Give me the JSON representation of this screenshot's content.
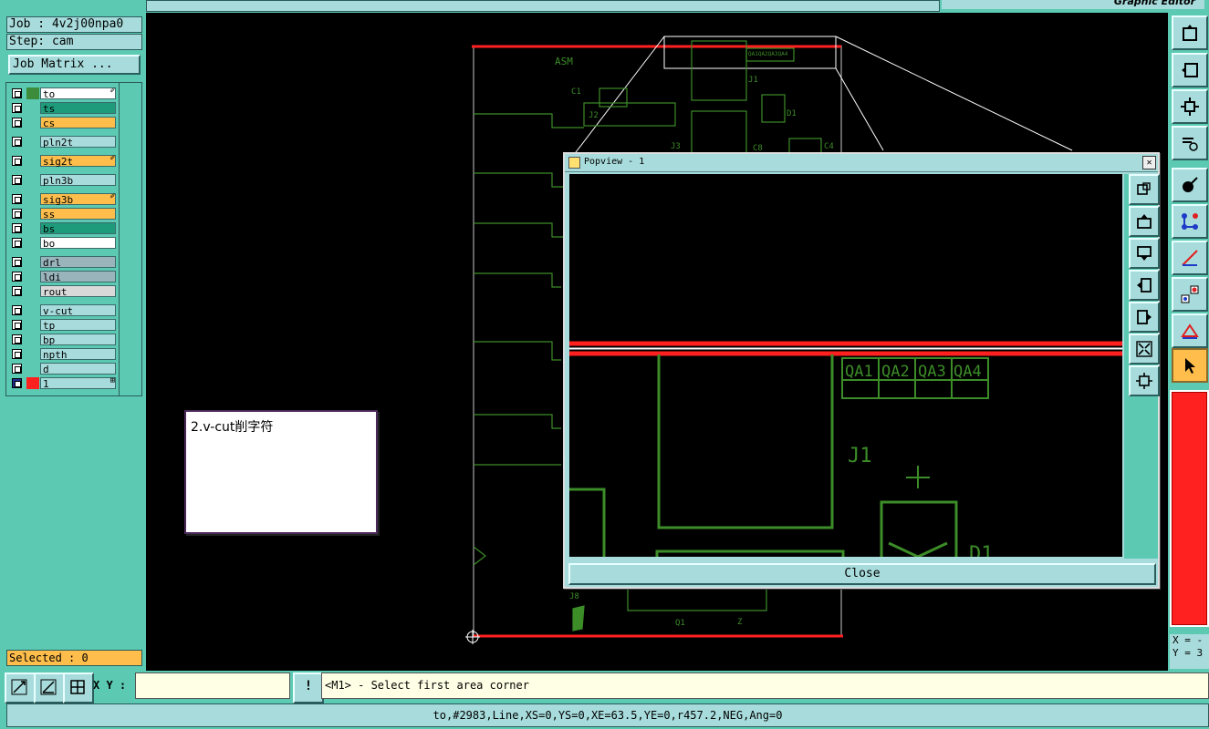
{
  "header": {
    "right_title": "Graphic Editor"
  },
  "job": {
    "job_label": "Job : 4v2j00npa0",
    "step_label": "Step: cam",
    "matrix_button": "Job Matrix ..."
  },
  "layers": [
    {
      "name": "to",
      "swatch": "#3c8c3c",
      "bg": "#ffffff",
      "edit": "✐"
    },
    {
      "name": "ts",
      "swatch": "#5ccab3",
      "bg": "#1e9b7b",
      "edit": ""
    },
    {
      "name": "cs",
      "swatch": "#5ccab3",
      "bg": "#ffbe4b",
      "edit": ""
    },
    {
      "name": "pln2t",
      "swatch": "#5ccab3",
      "bg": "#a8dcdc",
      "edit": ""
    },
    {
      "name": "sig2t",
      "swatch": "#5ccab3",
      "bg": "#ffbe4b",
      "edit": "✐"
    },
    {
      "name": "pln3b",
      "swatch": "#5ccab3",
      "bg": "#a8dcdc",
      "edit": ""
    },
    {
      "name": "sig3b",
      "swatch": "#5ccab3",
      "bg": "#ffbe4b",
      "edit": "✐"
    },
    {
      "name": "ss",
      "swatch": "#5ccab3",
      "bg": "#ffbe4b",
      "edit": ""
    },
    {
      "name": "bs",
      "swatch": "#5ccab3",
      "bg": "#1e9b7b",
      "edit": ""
    },
    {
      "name": "bo",
      "swatch": "#5ccab3",
      "bg": "#ffffff",
      "edit": ""
    },
    {
      "name": "drl",
      "swatch": "#5ccab3",
      "bg": "#9ab4bc",
      "edit": ""
    },
    {
      "name": "ldi",
      "swatch": "#5ccab3",
      "bg": "#9ab4bc",
      "edit": ""
    },
    {
      "name": "rout",
      "swatch": "#5ccab3",
      "bg": "#d9d9d9",
      "edit": ""
    },
    {
      "name": "v-cut",
      "swatch": "#5ccab3",
      "bg": "#a8dcdc",
      "edit": ""
    },
    {
      "name": "tp",
      "swatch": "#5ccab3",
      "bg": "#a8dcdc",
      "edit": ""
    },
    {
      "name": "bp",
      "swatch": "#5ccab3",
      "bg": "#a8dcdc",
      "edit": ""
    },
    {
      "name": "npth",
      "swatch": "#5ccab3",
      "bg": "#a8dcdc",
      "edit": ""
    },
    {
      "name": "d",
      "swatch": "#5ccab3",
      "bg": "#a8dcdc",
      "edit": ""
    },
    {
      "name": "1",
      "swatch": "#ff2020",
      "bg": "#a8dcdc",
      "edit": "⊞"
    }
  ],
  "selected": "Selected : 0",
  "note": {
    "text": "2.v-cut削字符"
  },
  "board": {
    "silk": [
      "ASM",
      "C1",
      "J2",
      "J1",
      "D1",
      "C4",
      "C8",
      "J3",
      "13",
      "10",
      "11",
      "9",
      "J8",
      "Z"
    ],
    "logo": "P",
    "tiny_labels": [
      "QA1QA2QA3QA4"
    ]
  },
  "popview": {
    "title": "Popview - 1",
    "close_x": "✕",
    "close_button": "Close",
    "labels": [
      "QA1",
      "QA2",
      "QA3",
      "QA4",
      "J1",
      "D1"
    ]
  },
  "toolbar": {
    "xy_label": "X Y :",
    "xy_value": "",
    "info_button": "!"
  },
  "prompt": "<M1> - Select first area corner",
  "status": "to,#2983,Line,XS=0,YS=0,XE=63.5,YE=0,r457.2,NEG,Ang=0",
  "coords": {
    "x": "X = -",
    "y": "Y = 3"
  },
  "colors": {
    "teal": "#5ccab3",
    "trace": "#3c8c28",
    "highlight": "#ff2020"
  }
}
